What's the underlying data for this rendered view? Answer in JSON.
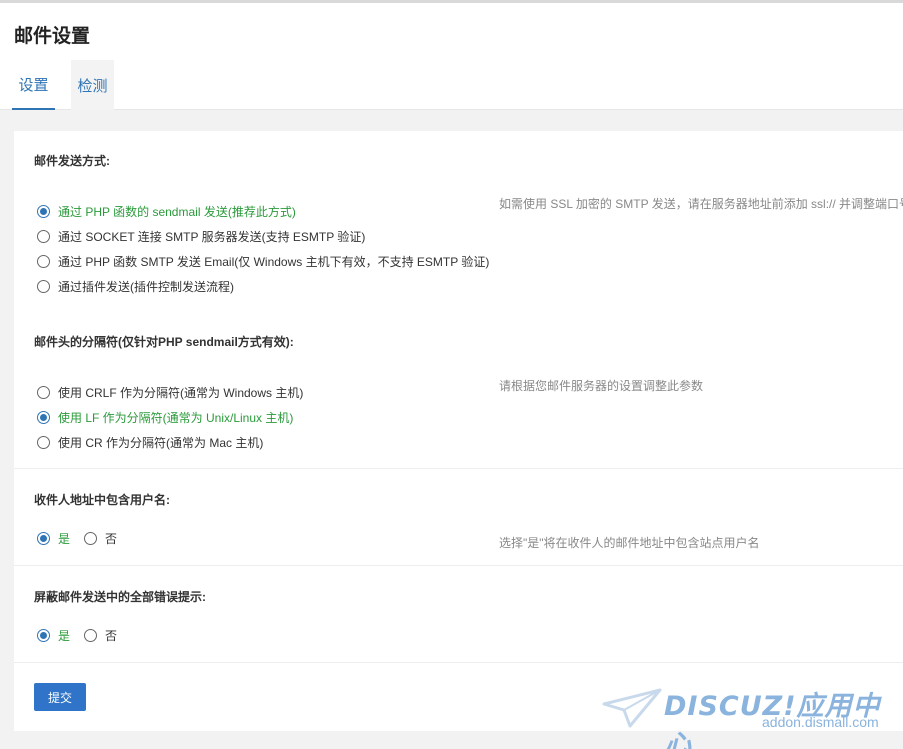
{
  "page": {
    "title": "邮件设置"
  },
  "tabs": [
    {
      "label": "设置",
      "active": true
    },
    {
      "label": "检测",
      "active": false
    }
  ],
  "send_method": {
    "title": "邮件发送方式:",
    "hint": "如需使用 SSL 加密的 SMTP 发送，请在服务器地址前添加 ssl:// 并调整端口号",
    "options": [
      {
        "label": "通过 PHP 函数的 sendmail 发送(推荐此方式)",
        "checked": true
      },
      {
        "label": "通过 SOCKET 连接 SMTP 服务器发送(支持 ESMTP 验证)",
        "checked": false
      },
      {
        "label": "通过 PHP 函数 SMTP 发送 Email(仅 Windows 主机下有效，不支持 ESMTP 验证)",
        "checked": false
      },
      {
        "label": "通过插件发送(插件控制发送流程)",
        "checked": false
      }
    ]
  },
  "header_separator": {
    "title": "邮件头的分隔符(仅针对PHP sendmail方式有效):",
    "hint": "请根据您邮件服务器的设置调整此参数",
    "options": [
      {
        "label": "使用 CRLF 作为分隔符(通常为 Windows 主机)",
        "checked": false
      },
      {
        "label": "使用 LF 作为分隔符(通常为 Unix/Linux 主机)",
        "checked": true
      },
      {
        "label": "使用 CR 作为分隔符(通常为 Mac 主机)",
        "checked": false
      }
    ]
  },
  "include_username": {
    "title": "收件人地址中包含用户名:",
    "hint": "选择\"是\"将在收件人的邮件地址中包含站点用户名",
    "yes_label": "是",
    "no_label": "否",
    "value": "yes"
  },
  "suppress_errors": {
    "title": "屏蔽邮件发送中的全部错误提示:",
    "yes_label": "是",
    "no_label": "否",
    "value": "yes"
  },
  "submit_label": "提交",
  "watermark": {
    "brand": "DISCUZ!应用中心",
    "url": "addon.dismall.com"
  },
  "colors": {
    "accent": "#2f74b5",
    "checked_text": "#2a9a3a",
    "hint": "#888888"
  }
}
